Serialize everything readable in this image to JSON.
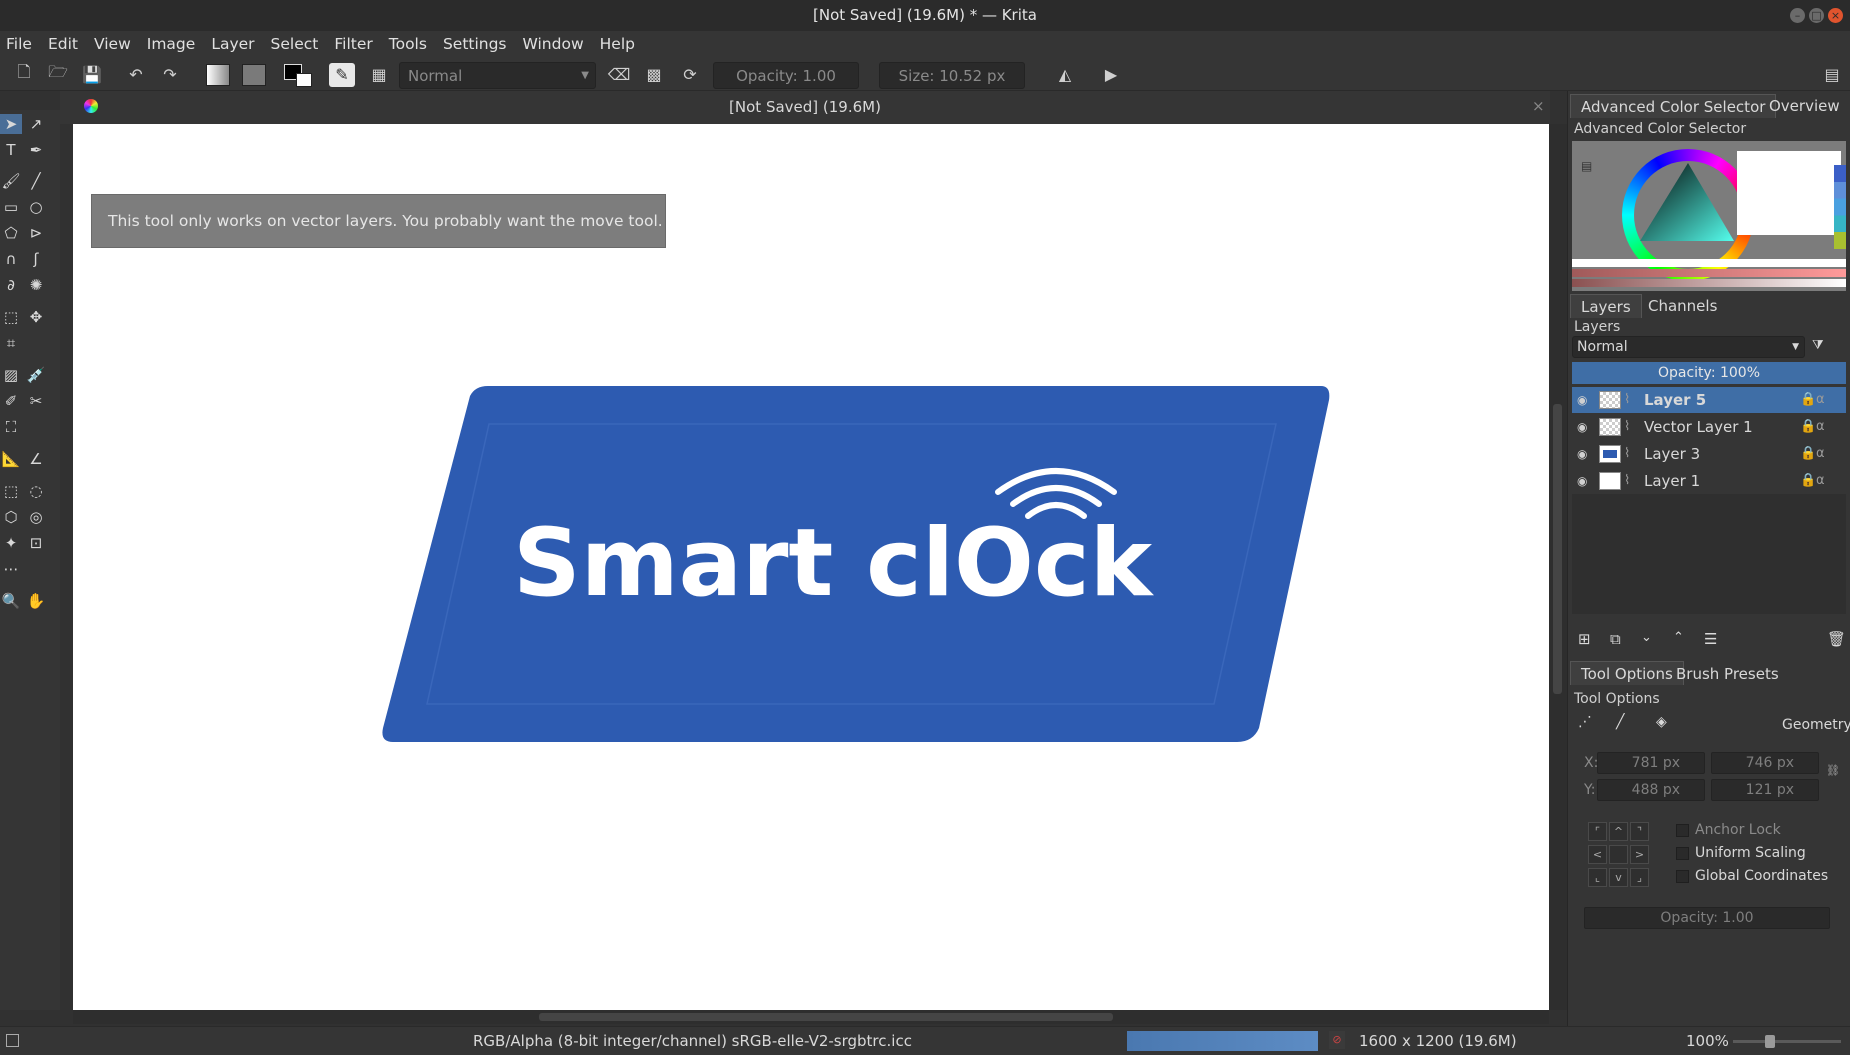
{
  "window": {
    "title": "[Not Saved]  (19.6M) * — Krita"
  },
  "menu": [
    "File",
    "Edit",
    "View",
    "Image",
    "Layer",
    "Select",
    "Filter",
    "Tools",
    "Settings",
    "Window",
    "Help"
  ],
  "toolbar": {
    "blend_mode": "Normal",
    "opacity_label": "Opacity: 1.00",
    "size_label": "Size: 10.52 px"
  },
  "document": {
    "tab_title": "[Not Saved]  (19.6M)",
    "tool_message": "This tool only works on vector layers. You probably want the move tool.",
    "artwork_text": "Smart clOck"
  },
  "colors": {
    "accent": "#3f6ea6",
    "artwork_blue": "#2d5bb1",
    "canvas": "#ffffff"
  },
  "dock": {
    "color_tabs": [
      "Advanced Color Selector",
      "Overview"
    ],
    "color_title": "Advanced Color Selector",
    "layer_tabs": [
      "Layers",
      "Channels"
    ],
    "layers_title": "Layers",
    "layers_blend": "Normal",
    "layers_opacity": "Opacity:  100%",
    "layers": [
      {
        "name": "Layer 5",
        "selected": true
      },
      {
        "name": "Vector Layer 1",
        "selected": false
      },
      {
        "name": "Layer 3",
        "selected": false
      },
      {
        "name": "Layer 1",
        "selected": false
      }
    ],
    "option_tabs": [
      "Tool Options",
      "Brush Presets"
    ],
    "options_title": "Tool Options",
    "geometry_label": "Geometry",
    "x_label": "X:",
    "y_label": "Y:",
    "x_value": "781 px",
    "y_value": "488 px",
    "w_value": "746 px",
    "h_value": "121 px",
    "anchor_lock": "Anchor Lock",
    "uniform_scaling": "Uniform Scaling",
    "global_coords": "Global Coordinates",
    "opacity_field": "Opacity: 1.00"
  },
  "status": {
    "color_space": "RGB/Alpha (8-bit integer/channel)  sRGB-elle-V2-srgbtrc.icc",
    "image_size": "1600 x 1200 (19.6M)",
    "zoom": "100%"
  }
}
